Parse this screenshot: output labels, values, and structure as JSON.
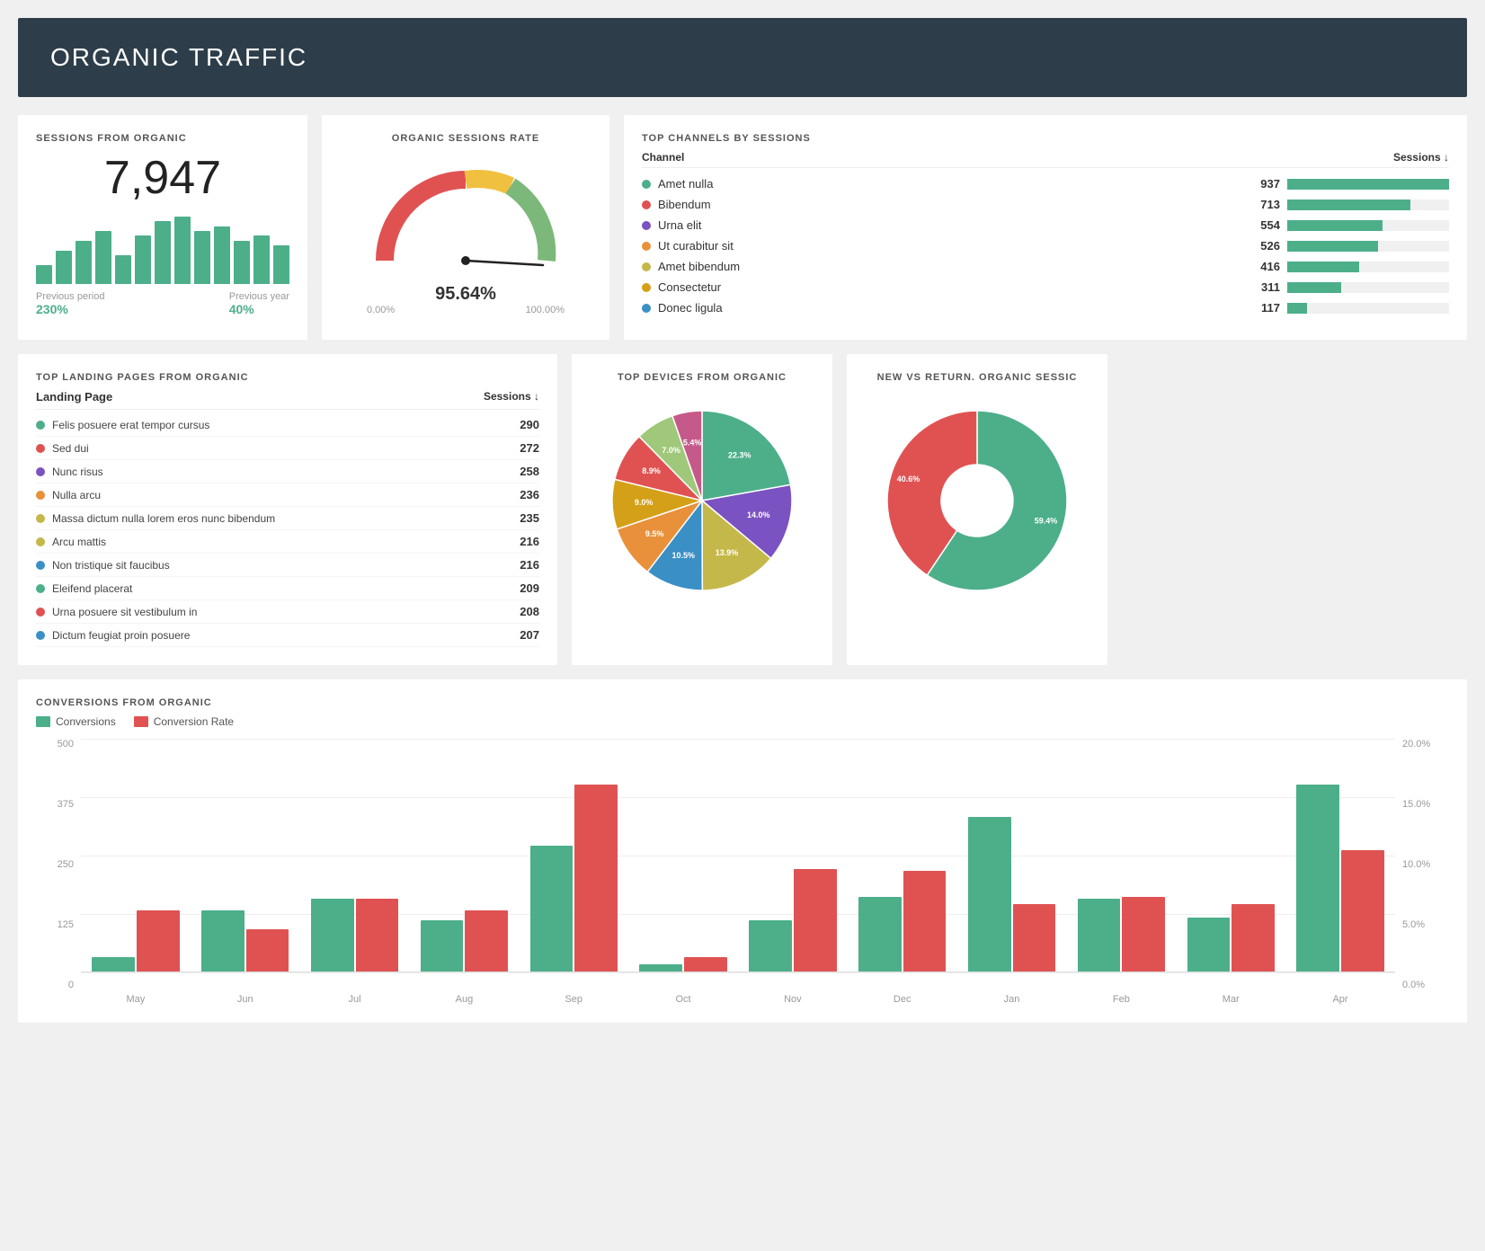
{
  "header": {
    "title": "ORGANIC TRAFFIC"
  },
  "sessions_organic": {
    "title": "SESSIONS FROM ORGANIC",
    "value": "7,947",
    "bars": [
      20,
      35,
      45,
      55,
      30,
      50,
      65,
      70,
      55,
      60,
      45,
      50,
      40
    ],
    "previous_period_label": "Previous period",
    "previous_period_value": "230%",
    "previous_year_label": "Previous year",
    "previous_year_value": "40%"
  },
  "gauge": {
    "title": "ORGANIC SESSIONS RATE",
    "value": "95.64%",
    "min": "0.00%",
    "max": "100.00%",
    "percent": 0.9564
  },
  "channels": {
    "title": "TOP CHANNELS BY SESSIONS",
    "col1": "Channel",
    "col2": "Sessions",
    "max": 937,
    "items": [
      {
        "name": "Amet nulla",
        "value": 937,
        "color": "#4caf8a"
      },
      {
        "name": "Bibendum",
        "value": 713,
        "color": "#e05252"
      },
      {
        "name": "Urna elit",
        "value": 554,
        "color": "#7b52c1"
      },
      {
        "name": "Ut curabitur sit",
        "value": 526,
        "color": "#e8913a"
      },
      {
        "name": "Amet bibendum",
        "value": 416,
        "color": "#c5b84a"
      },
      {
        "name": "Consectetur",
        "value": 311,
        "color": "#d4a017"
      },
      {
        "name": "Donec ligula",
        "value": 117,
        "color": "#3a8fc5"
      }
    ]
  },
  "landing_pages": {
    "title": "TOP LANDING PAGES FROM ORGANIC",
    "col1": "Landing Page",
    "col2": "Sessions",
    "items": [
      {
        "name": "Felis posuere erat tempor cursus",
        "value": 290,
        "color": "#4caf8a"
      },
      {
        "name": "Sed dui",
        "value": 272,
        "color": "#e05252"
      },
      {
        "name": "Nunc risus",
        "value": 258,
        "color": "#7b52c1"
      },
      {
        "name": "Nulla arcu",
        "value": 236,
        "color": "#e8913a"
      },
      {
        "name": "Massa dictum nulla lorem eros nunc bibendum",
        "value": 235,
        "color": "#c5b84a"
      },
      {
        "name": "Arcu mattis",
        "value": 216,
        "color": "#c5b84a"
      },
      {
        "name": "Non tristique sit faucibus",
        "value": 216,
        "color": "#3a8fc5"
      },
      {
        "name": "Eleifend placerat",
        "value": 209,
        "color": "#4caf8a"
      },
      {
        "name": "Urna posuere sit vestibulum in",
        "value": 208,
        "color": "#e05252"
      },
      {
        "name": "Dictum feugiat proin posuere",
        "value": 207,
        "color": "#3a8fc5"
      }
    ]
  },
  "devices": {
    "title": "TOP DEVICES FROM ORGANIC",
    "slices": [
      {
        "label": "22.3%",
        "color": "#4caf8a",
        "value": 22.3
      },
      {
        "label": "14.0%",
        "color": "#7b52c1",
        "value": 14.0
      },
      {
        "label": "13.9%",
        "color": "#c5b84a",
        "value": 13.9
      },
      {
        "label": "10.5%",
        "color": "#3a8fc5",
        "value": 10.5
      },
      {
        "label": "9.5%",
        "color": "#e8913a",
        "value": 9.5
      },
      {
        "label": "9.0%",
        "color": "#d4a017",
        "value": 9.0
      },
      {
        "label": "8.9%",
        "color": "#e05252",
        "value": 8.9
      },
      {
        "label": "7.0%",
        "color": "#a0c87a",
        "value": 7.0
      },
      {
        "label": "5.4%",
        "color": "#c55a8a",
        "value": 5.4
      }
    ]
  },
  "new_vs_return": {
    "title": "NEW VS RETURN. ORGANIC SESSIC",
    "slices": [
      {
        "label": "59.4%",
        "color": "#4caf8a",
        "value": 59.4
      },
      {
        "label": "40.6%",
        "color": "#e05252",
        "value": 40.6
      }
    ]
  },
  "conversions": {
    "title": "CONVERSIONS FROM ORGANIC",
    "legend": [
      {
        "label": "Conversions",
        "color": "#4caf8a"
      },
      {
        "label": "Conversion Rate",
        "color": "#e05252"
      }
    ],
    "y_left": [
      "500",
      "375",
      "250",
      "125",
      "0"
    ],
    "y_right": [
      "20.0%",
      "15.0%",
      "10.0%",
      "5.0%",
      "0.0%"
    ],
    "months": [
      {
        "label": "May",
        "conv": 30,
        "rate": 130
      },
      {
        "label": "Jun",
        "conv": 130,
        "rate": 90
      },
      {
        "label": "Jul",
        "conv": 155,
        "rate": 155
      },
      {
        "label": "Aug",
        "conv": 110,
        "rate": 130
      },
      {
        "label": "Sep",
        "conv": 270,
        "rate": 400
      },
      {
        "label": "Oct",
        "conv": 15,
        "rate": 30
      },
      {
        "label": "Nov",
        "conv": 110,
        "rate": 220
      },
      {
        "label": "Dec",
        "conv": 160,
        "rate": 215
      },
      {
        "label": "Jan",
        "conv": 330,
        "rate": 145
      },
      {
        "label": "Feb",
        "conv": 155,
        "rate": 160
      },
      {
        "label": "Mar",
        "conv": 115,
        "rate": 145
      },
      {
        "label": "Apr",
        "conv": 400,
        "rate": 260
      }
    ],
    "max_conv": 500
  }
}
